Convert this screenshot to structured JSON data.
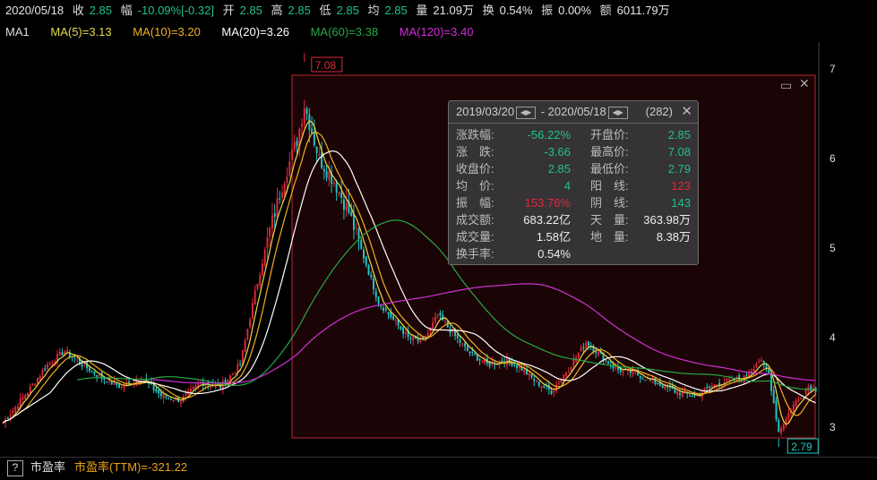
{
  "header": {
    "date": "2020/05/18",
    "close_label": "收",
    "close_value": "2.85",
    "change_label": "幅",
    "change_value": "-10.09%[-0.32]",
    "open_label": "开",
    "open_value": "2.85",
    "high_label": "高",
    "high_value": "2.85",
    "low_label": "低",
    "low_value": "2.85",
    "avg_label": "均",
    "avg_value": "2.85",
    "volume_label": "量",
    "volume_value": "21.09万",
    "turnover_label": "换",
    "turnover_value": "0.54%",
    "amplitude_label": "振",
    "amplitude_value": "0.00%",
    "amount_label": "额",
    "amount_value": "6011.79万"
  },
  "ma_bar": {
    "ma1_label": "MA1",
    "ma5": "MA(5)=3.13",
    "ma10": "MA(10)=3.20",
    "ma20": "MA(20)=3.26",
    "ma60": "MA(60)=3.38",
    "ma120": "MA(120)=3.40"
  },
  "colors": {
    "up": "#e0293a",
    "down": "#21c8c8",
    "ma5": "#e8d84a",
    "ma10": "#f0b020",
    "ma20": "#ffffff",
    "ma60": "#27a845",
    "ma120": "#d030d8",
    "selection": "#b52a33"
  },
  "stats_panel": {
    "range_start": "2019/03/20",
    "range_sep": "-",
    "range_end": "2020/05/18",
    "count": "(282)",
    "close_icon": "close-icon",
    "rows": [
      {
        "k1": "涨跌幅:",
        "v1": "-56.22%",
        "c1": "dn",
        "k2": "开盘价:",
        "v2": "2.85",
        "c2": "dn"
      },
      {
        "k1": "涨　跌:",
        "v1": "-3.66",
        "c1": "dn",
        "k2": "最高价:",
        "v2": "7.08",
        "c2": "dn"
      },
      {
        "k1": "收盘价:",
        "v1": "2.85",
        "c1": "dn",
        "k2": "最低价:",
        "v2": "2.79",
        "c2": "dn"
      },
      {
        "k1": "均　价:",
        "v1": "4",
        "c1": "dn",
        "k2": "阳　线:",
        "v2": "123",
        "c2": "up"
      },
      {
        "k1": "振　幅:",
        "v1": "153.76%",
        "c1": "up",
        "k2": "阴　线:",
        "v2": "143",
        "c2": "dn"
      },
      {
        "k1": "成交额:",
        "v1": "683.22亿",
        "c1": "wv",
        "k2": "天　量:",
        "v2": "363.98万",
        "c2": "wv"
      },
      {
        "k1": "成交量:",
        "v1": "1.58亿",
        "c1": "wv",
        "k2": "地　量:",
        "v2": "8.38万",
        "c2": "wv"
      },
      {
        "k1": "换手率:",
        "v1": "0.54%",
        "c1": "wv",
        "k2": "",
        "v2": "",
        "c2": "wv"
      }
    ]
  },
  "bottom_bar": {
    "help": "?",
    "pe_label": "市盈率",
    "pe_value": "市盈率(TTM)=-321.22"
  },
  "chart_data": {
    "type": "candlestick",
    "y_ticks": [
      "3",
      "4",
      "5",
      "6",
      "7"
    ],
    "ylim": [
      2.7,
      7.3
    ],
    "high_marker": "7.08",
    "low_marker": "2.79",
    "icons": [
      "restore-icon",
      "close-icon"
    ],
    "n_candles": 330,
    "series": [
      {
        "name": "MA5",
        "color": "#e8d84a"
      },
      {
        "name": "MA10",
        "color": "#f0b020"
      },
      {
        "name": "MA20",
        "color": "#ffffff"
      },
      {
        "name": "MA60",
        "color": "#27a845"
      },
      {
        "name": "MA120",
        "color": "#d030d8"
      }
    ],
    "close_anchors": [
      [
        0,
        3.05
      ],
      [
        10,
        3.4
      ],
      [
        18,
        3.7
      ],
      [
        25,
        3.85
      ],
      [
        32,
        3.7
      ],
      [
        40,
        3.55
      ],
      [
        48,
        3.45
      ],
      [
        56,
        3.55
      ],
      [
        64,
        3.35
      ],
      [
        72,
        3.3
      ],
      [
        80,
        3.5
      ],
      [
        88,
        3.45
      ],
      [
        96,
        3.7
      ],
      [
        102,
        4.5
      ],
      [
        108,
        5.2
      ],
      [
        114,
        5.8
      ],
      [
        119,
        6.2
      ],
      [
        122,
        6.6
      ],
      [
        124,
        6.4
      ],
      [
        128,
        6.0
      ],
      [
        134,
        5.75
      ],
      [
        140,
        5.4
      ],
      [
        146,
        4.9
      ],
      [
        152,
        4.4
      ],
      [
        158,
        4.2
      ],
      [
        164,
        4.0
      ],
      [
        170,
        3.95
      ],
      [
        176,
        4.25
      ],
      [
        182,
        4.05
      ],
      [
        188,
        3.85
      ],
      [
        196,
        3.7
      ],
      [
        204,
        3.75
      ],
      [
        210,
        3.65
      ],
      [
        216,
        3.5
      ],
      [
        222,
        3.4
      ],
      [
        230,
        3.7
      ],
      [
        236,
        3.95
      ],
      [
        242,
        3.8
      ],
      [
        248,
        3.65
      ],
      [
        256,
        3.6
      ],
      [
        264,
        3.5
      ],
      [
        272,
        3.4
      ],
      [
        280,
        3.35
      ],
      [
        290,
        3.5
      ],
      [
        300,
        3.55
      ],
      [
        306,
        3.75
      ],
      [
        310,
        3.6
      ],
      [
        314,
        2.95
      ],
      [
        320,
        3.25
      ],
      [
        326,
        3.45
      ],
      [
        332,
        3.4
      ],
      [
        340,
        3.9
      ],
      [
        344,
        3.55
      ],
      [
        352,
        3.4
      ],
      [
        360,
        3.25
      ],
      [
        368,
        3.2
      ],
      [
        374,
        3.5
      ],
      [
        380,
        3.3
      ],
      [
        388,
        3.2
      ],
      [
        396,
        3.2
      ],
      [
        402,
        3.1
      ],
      [
        404,
        2.9
      ],
      [
        405,
        2.85
      ]
    ]
  }
}
